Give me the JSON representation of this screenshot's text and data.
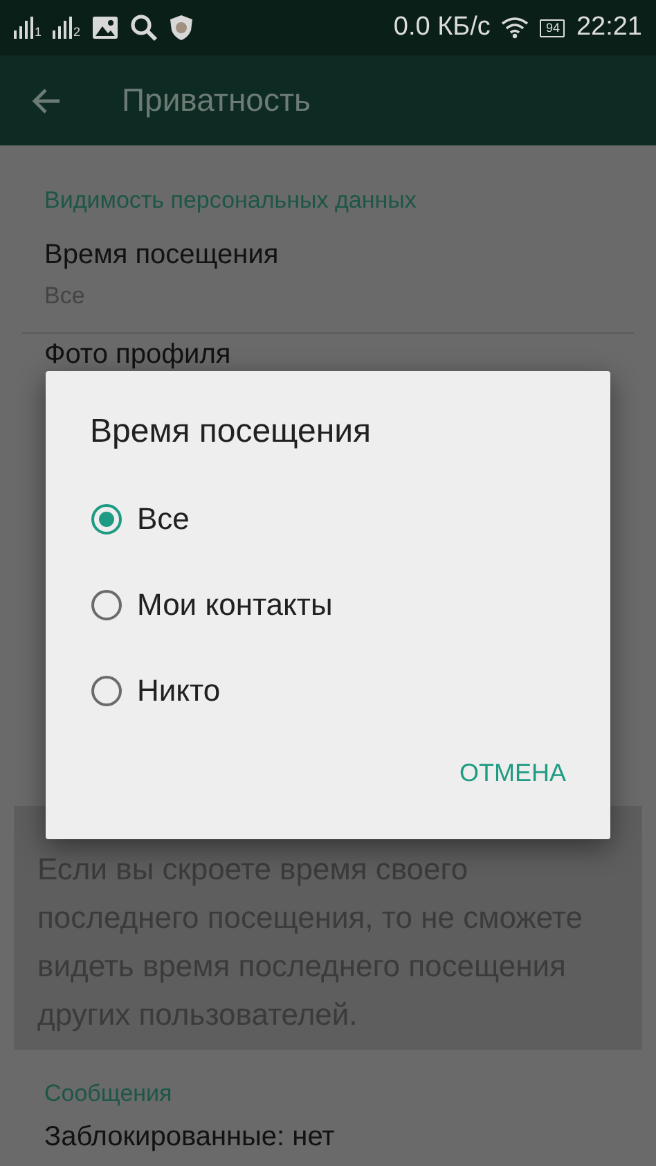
{
  "status_bar": {
    "sims": [
      {
        "index": "1"
      },
      {
        "index": "2"
      }
    ],
    "speed": "0.0 КБ/с",
    "battery": "94",
    "time": "22:21"
  },
  "app_bar": {
    "title": "Приватность"
  },
  "visibility_section": {
    "header": "Видимость персональных данных",
    "items": [
      {
        "title": "Время посещения",
        "value": "Все"
      },
      {
        "title": "Фото профиля"
      }
    ]
  },
  "info_text": "Если вы скроете время своего последнего посещения, то не сможете видеть время последнего посещения других пользователей.",
  "messages_section": {
    "header": "Сообщения",
    "items": [
      {
        "title": "Заблокированные: нет"
      }
    ]
  },
  "dialog": {
    "title": "Время посещения",
    "options": [
      {
        "label": "Все",
        "selected": true
      },
      {
        "label": "Мои контакты",
        "selected": false
      },
      {
        "label": "Никто",
        "selected": false
      }
    ],
    "buttons": [
      "ОТМЕНА"
    ]
  }
}
